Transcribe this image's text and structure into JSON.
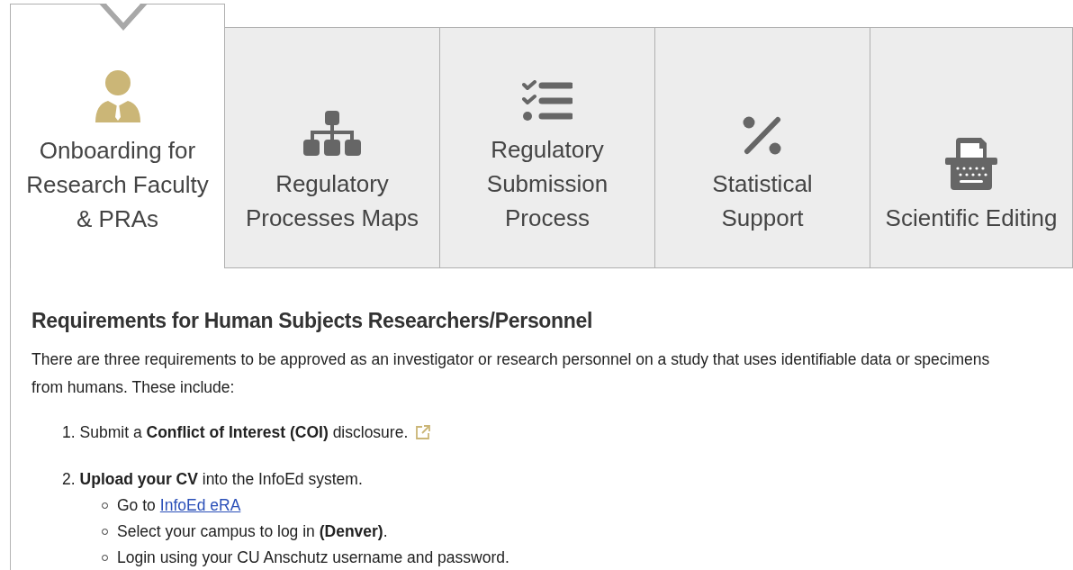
{
  "tabs": [
    {
      "lines": [
        "Onboarding for",
        "Research Faculty",
        "& PRAs"
      ],
      "selected": true
    },
    {
      "lines": [
        "Regulatory",
        "Processes Maps"
      ],
      "selected": false
    },
    {
      "lines": [
        "Regulatory",
        "Submission",
        "Process"
      ],
      "selected": false
    },
    {
      "lines": [
        "Statistical",
        "Support"
      ],
      "selected": false
    },
    {
      "lines": [
        "Scientific Editing"
      ],
      "selected": false
    }
  ],
  "content": {
    "heading": "Requirements for Human Subjects Researchers/Personnel",
    "intro": "There are three requirements to be approved as an investigator or research personnel on a study that uses identifiable data or specimens from humans. These include:",
    "steps": [
      {
        "number": "1.",
        "text": "Submit a **Conflict of Interest (COI)** disclosure.",
        "external_link": true
      },
      {
        "number": "2.",
        "text": "**Upload your CV** into the InfoEd system.",
        "external_link": false,
        "subitems": [
          {
            "text": "Go to",
            "link": "InfoEd eRA"
          },
          {
            "text": "Select your campus to log in **(Denver)**."
          },
          {
            "text": "Login using your CU Anschutz username and password."
          }
        ]
      }
    ]
  }
}
